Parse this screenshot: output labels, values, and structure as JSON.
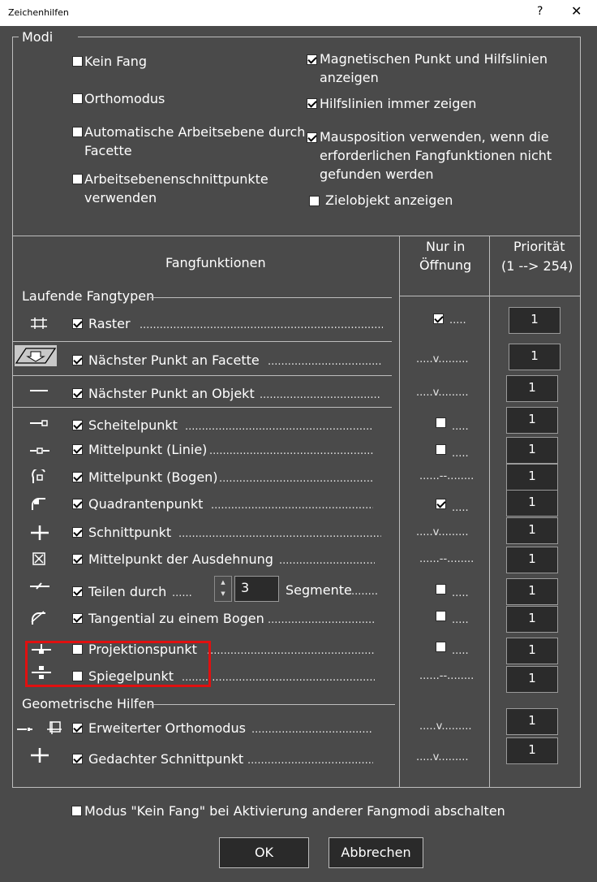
{
  "window": {
    "title": "Zeichenhilfen",
    "help": "?",
    "close": "✕"
  },
  "modi": {
    "legend": "Modi",
    "options": {
      "kein_fang": {
        "label": "Kein Fang",
        "checked": false
      },
      "orthomodus": {
        "label": "Orthomodus",
        "checked": false
      },
      "auto_ebene_1": "Automatische Arbeitsebene durch",
      "auto_ebene_2": "Facette",
      "auto_ebene_checked": false,
      "schnittpunkte_1": "Arbeitsebenenschnittpunkte",
      "schnittpunkte_2": "verwenden",
      "schnittpunkte_checked": false,
      "magnetisch_1": "Magnetischen Punkt und Hilfslinien",
      "magnetisch_2": "anzeigen",
      "magnetisch_checked": true,
      "hilfslinien": {
        "label": "Hilfslinien immer zeigen",
        "checked": true
      },
      "maus_1": "Mausposition verwenden, wenn die",
      "maus_2": "erforderlichen Fangfunktionen nicht",
      "maus_3": "gefunden werden",
      "maus_checked": true,
      "zielobjekt": {
        "label": "Zielobjekt anzeigen",
        "checked": false
      }
    }
  },
  "table": {
    "col_fang": "Fangfunktionen",
    "col_nur_1": "Nur in",
    "col_nur_2": "Öffnung",
    "col_prio_1": "Priorität",
    "col_prio_2": "(1 --> 254)",
    "group_laufend": "Laufende Fangtypen",
    "group_geom": "Geometrische Hilfen",
    "rows": {
      "raster": {
        "label": "Raster",
        "checked": true,
        "nur": "check",
        "nur_checked": true,
        "prio": "1",
        "icon": "grid-icon"
      },
      "facette": {
        "label": "Nächster Punkt an Facette",
        "checked": true,
        "nur": "v",
        "prio": "1",
        "icon": "facet-icon"
      },
      "objekt": {
        "label": "Nächster Punkt an Objekt",
        "checked": true,
        "nur": "v",
        "prio": "1",
        "icon": "line-icon"
      },
      "scheitel": {
        "label": "Scheitelpunkt",
        "checked": true,
        "nur": "check",
        "nur_checked": false,
        "prio": "1",
        "icon": "endpoint-icon"
      },
      "mittel_linie": {
        "label": "Mittelpunkt (Linie)",
        "checked": true,
        "nur": "check",
        "nur_checked": false,
        "prio": "1",
        "icon": "midpoint-line-icon"
      },
      "mittel_bogen": {
        "label": "Mittelpunkt (Bogen)",
        "checked": true,
        "nur": "dash",
        "prio": "1",
        "icon": "midpoint-arc-icon"
      },
      "quadrant": {
        "label": "Quadrantenpunkt",
        "checked": true,
        "nur": "check",
        "nur_checked": true,
        "prio": "1",
        "icon": "quadrant-icon"
      },
      "schnitt": {
        "label": "Schnittpunkt",
        "checked": true,
        "nur": "v",
        "prio": "1",
        "icon": "intersection-icon"
      },
      "ausdehnung": {
        "label": "Mittelpunkt der Ausdehnung",
        "checked": true,
        "nur": "dash",
        "prio": "1",
        "icon": "extent-center-icon"
      },
      "teilen": {
        "label": "Teilen durch",
        "checked": true,
        "value": "3",
        "suffix": "Segmente",
        "nur": "check",
        "nur_checked": false,
        "prio": "1",
        "icon": "divide-icon"
      },
      "tangential": {
        "label": "Tangential zu einem Bogen",
        "checked": true,
        "nur": "check",
        "nur_checked": false,
        "prio": "1",
        "icon": "tangent-icon"
      },
      "projektion": {
        "label": "Projektionspunkt",
        "checked": false,
        "nur": "check",
        "nur_checked": false,
        "prio": "1",
        "icon": "projection-icon"
      },
      "spiegel": {
        "label": "Spiegelpunkt",
        "checked": false,
        "nur": "dash",
        "prio": "1",
        "icon": "mirror-icon"
      },
      "erw_ortho": {
        "label": "Erweiterter Orthomodus",
        "checked": true,
        "nur": "v",
        "prio": "1",
        "icon": "extended-ortho-icon"
      },
      "gedacht": {
        "label": "Gedachter Schnittpunkt",
        "checked": true,
        "nur": "v",
        "prio": "1",
        "icon": "virtual-intersection-icon"
      }
    },
    "dots_v": ".....v.........",
    "dots_dash": "......--........",
    "dots_short": ".....",
    "dots_long": ".........................................................................................",
    "dots_teilen": "......",
    "dots_seg": "........"
  },
  "footer": {
    "abschalten": {
      "label": "Modus \"Kein Fang\" bei Aktivierung anderer Fangmodi abschalten",
      "checked": false
    },
    "ok": "OK",
    "cancel": "Abbrechen"
  }
}
